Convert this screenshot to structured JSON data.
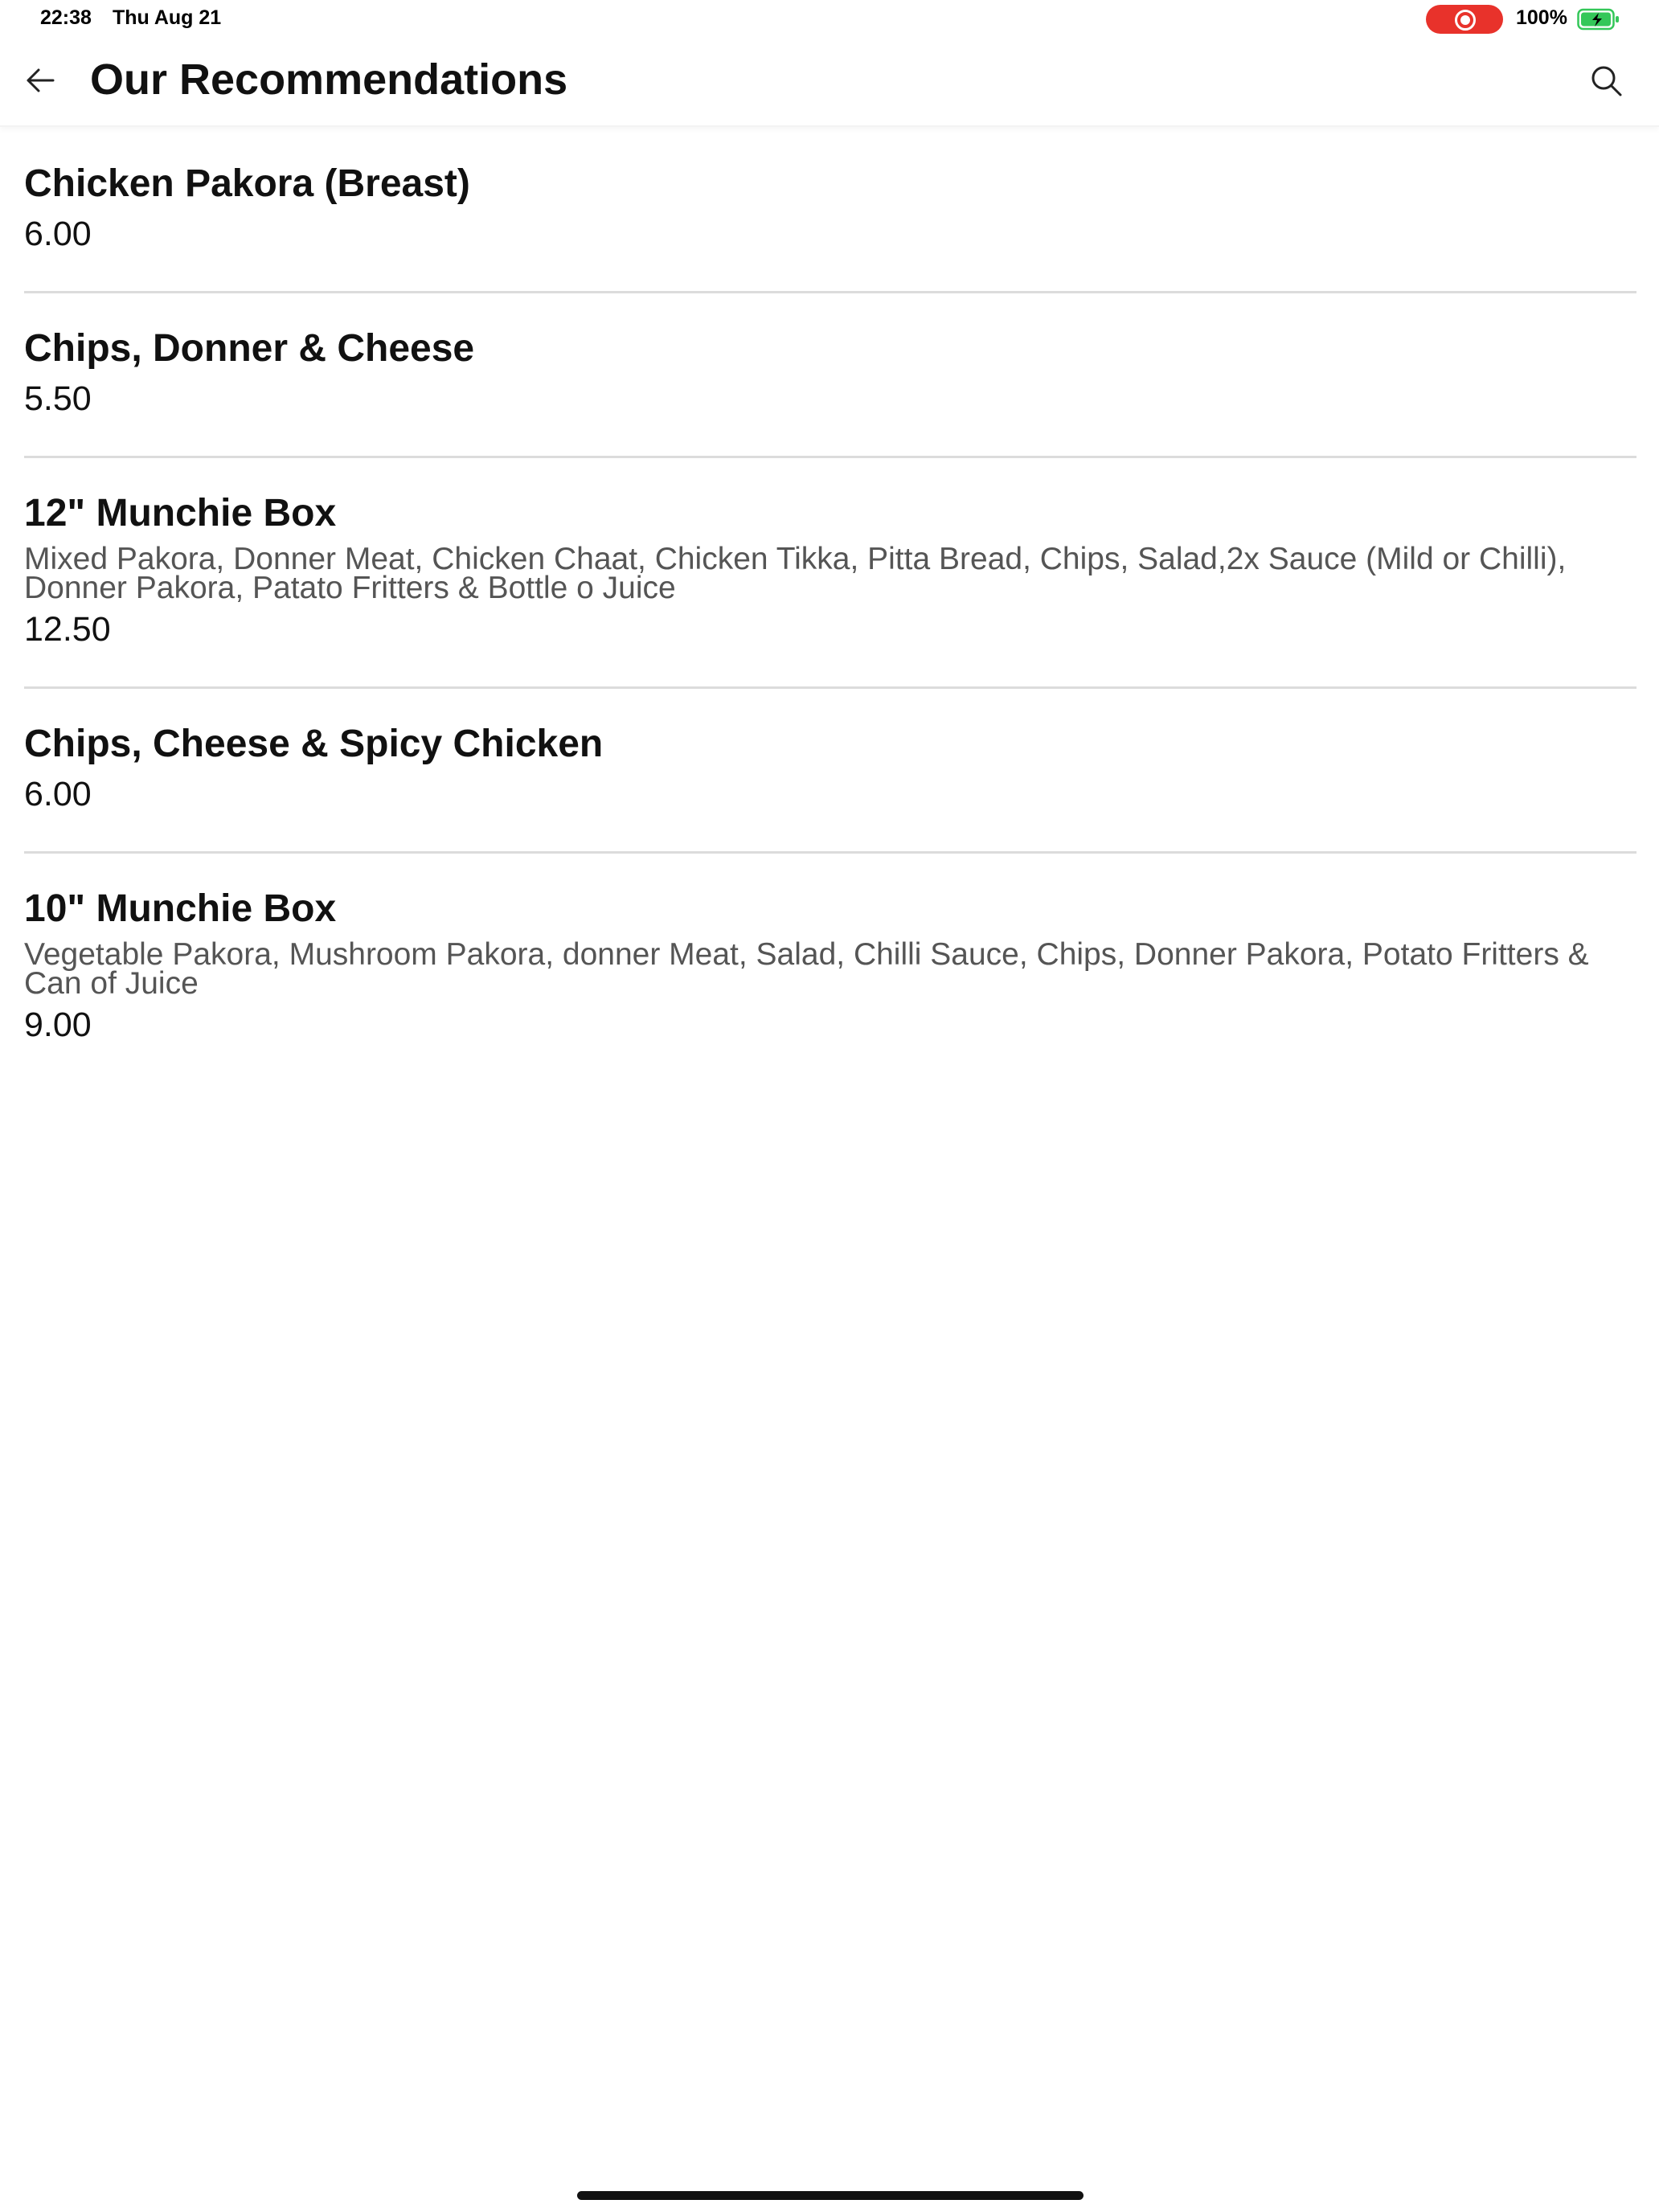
{
  "status_bar": {
    "time": "22:38",
    "date": "Thu Aug 21",
    "battery_percent": "100%",
    "recording_color": "#e8322b",
    "battery_color": "#34c759",
    "icons": [
      "screen-record-icon",
      "battery-charging-icon"
    ]
  },
  "header": {
    "title": "Our Recommendations",
    "back_icon": "arrow-left-icon",
    "search_icon": "search-icon"
  },
  "items": [
    {
      "name": "Chicken Pakora (Breast)",
      "description": "",
      "price": "6.00"
    },
    {
      "name": "Chips, Donner & Cheese",
      "description": "",
      "price": "5.50"
    },
    {
      "name": "12\" Munchie Box",
      "description": "Mixed Pakora, Donner Meat, Chicken Chaat, Chicken Tikka, Pitta Bread, Chips, Salad,2x Sauce (Mild or Chilli), Donner Pakora, Patato Fritters & Bottle o Juice",
      "price": "12.50"
    },
    {
      "name": "Chips, Cheese & Spicy Chicken",
      "description": "",
      "price": "6.00"
    },
    {
      "name": "10\" Munchie Box",
      "description": "Vegetable Pakora, Mushroom Pakora, donner Meat, Salad, Chilli Sauce, Chips, Donner Pakora, Potato Fritters & Can of Juice",
      "price": "9.00"
    }
  ]
}
